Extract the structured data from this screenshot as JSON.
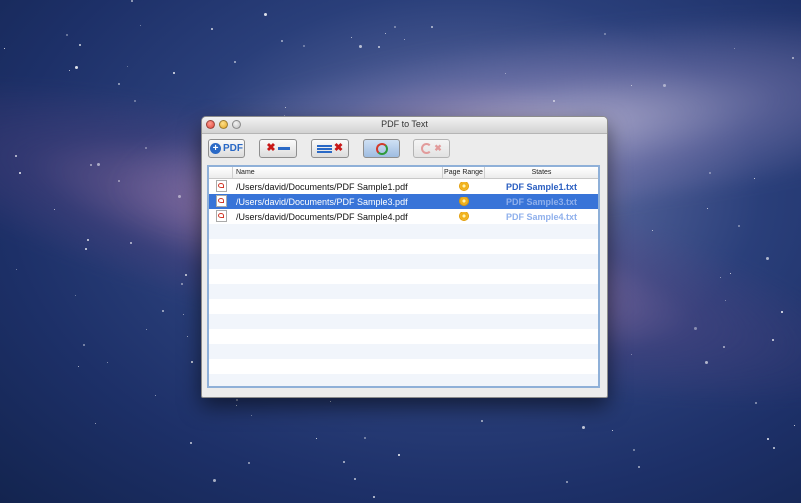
{
  "window": {
    "title": "PDF to Text"
  },
  "toolbar": {
    "add_label": "PDF"
  },
  "table": {
    "headers": {
      "name": "Name",
      "page_range": "Page Range",
      "states": "States"
    },
    "rows": [
      {
        "name": "/Users/david/Documents/PDF Sample1.pdf",
        "state": "PDF Sample1.txt",
        "selected": false
      },
      {
        "name": "/Users/david/Documents/PDF Sample3.pdf",
        "state": "PDF Sample3.txt",
        "selected": true
      },
      {
        "name": "/Users/david/Documents/PDF Sample4.pdf",
        "state": "PDF Sample4.txt",
        "selected": false
      }
    ],
    "empty_rows": 12
  },
  "icons": [
    "pdf-file-icon",
    "gear-icon",
    "add-pdf-icon",
    "remove-icon",
    "clear-list-icon",
    "convert-icon",
    "stop-icon"
  ]
}
